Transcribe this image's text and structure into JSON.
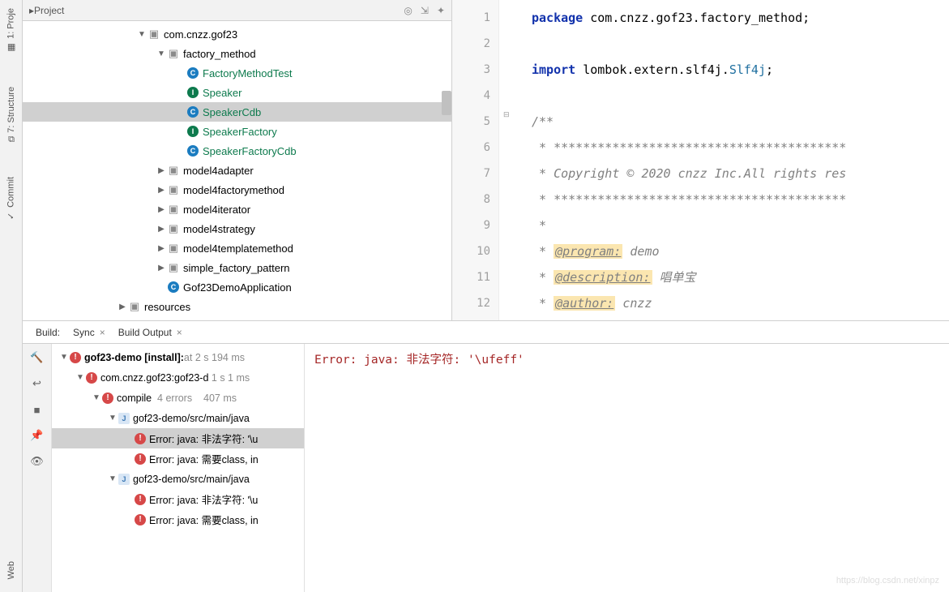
{
  "sidebar_tabs": {
    "project": "1: Proje",
    "structure": "7: Structure",
    "commit": "Commit",
    "web": "Web"
  },
  "project_header": {
    "title": "Project"
  },
  "tree": {
    "pkg": "com.cnzz.gof23",
    "factory_method": "factory_method",
    "factory_method_test": "FactoryMethodTest",
    "speaker": "Speaker",
    "speaker_cdb": "SpeakerCdb",
    "speaker_factory": "SpeakerFactory",
    "speaker_factory_cdb": "SpeakerFactoryCdb",
    "model4adapter": "model4adapter",
    "model4factorymethod": "model4factorymethod",
    "model4iterator": "model4iterator",
    "model4strategy": "model4strategy",
    "model4templatemethod": "model4templatemethod",
    "simple_factory_pattern": "simple_factory_pattern",
    "gof23_app": "Gof23DemoApplication",
    "resources": "resources"
  },
  "code": {
    "line1_kw": "package",
    "line1_rest": " com.cnzz.gof23.factory_method;",
    "line3_kw": "import",
    "line3_mid": " lombok.extern.slf4j.",
    "line3_cls": "Slf4j",
    "line3_end": ";",
    "line5": "/**",
    "line6": " * ****************************************",
    "line7": " * Copyright © 2020 cnzz Inc.All rights res",
    "line8": " * ****************************************",
    "line9": " *",
    "line10a": " * ",
    "line10_tag": "@program:",
    "line10b": " demo",
    "line11a": " * ",
    "line11_tag": "@description:",
    "line11_cjk": " 唱单宝",
    "line12a": " * ",
    "line12_tag": "@author:",
    "line12b": " cnzz"
  },
  "line_numbers": [
    "1",
    "2",
    "3",
    "4",
    "5",
    "6",
    "7",
    "8",
    "9",
    "10",
    "11",
    "12"
  ],
  "bottom_tabs": {
    "build": "Build:",
    "sync": "Sync",
    "build_output": "Build Output"
  },
  "build_tree": {
    "root": "gof23-demo [install]:",
    "root_suffix": " at",
    "root_time": "2 s 194 ms",
    "module": "com.cnzz.gof23:gof23-d",
    "module_time": "1 s 1 ms",
    "compile": "compile",
    "compile_errors": "4 errors",
    "compile_time": "407 ms",
    "src1": "gof23-demo/src/main/java",
    "err1": "Error: java: 非法字符: '\\u",
    "err2": "Error: java: 需要class, in",
    "src2": "gof23-demo/src/main/java",
    "err3": "Error: java: 非法字符: '\\u",
    "err4": "Error: java: 需要class, in"
  },
  "console_error": "Error: java: 非法字符: '\\ufeff'",
  "watermark": "https://blog.csdn.net/xinpz"
}
